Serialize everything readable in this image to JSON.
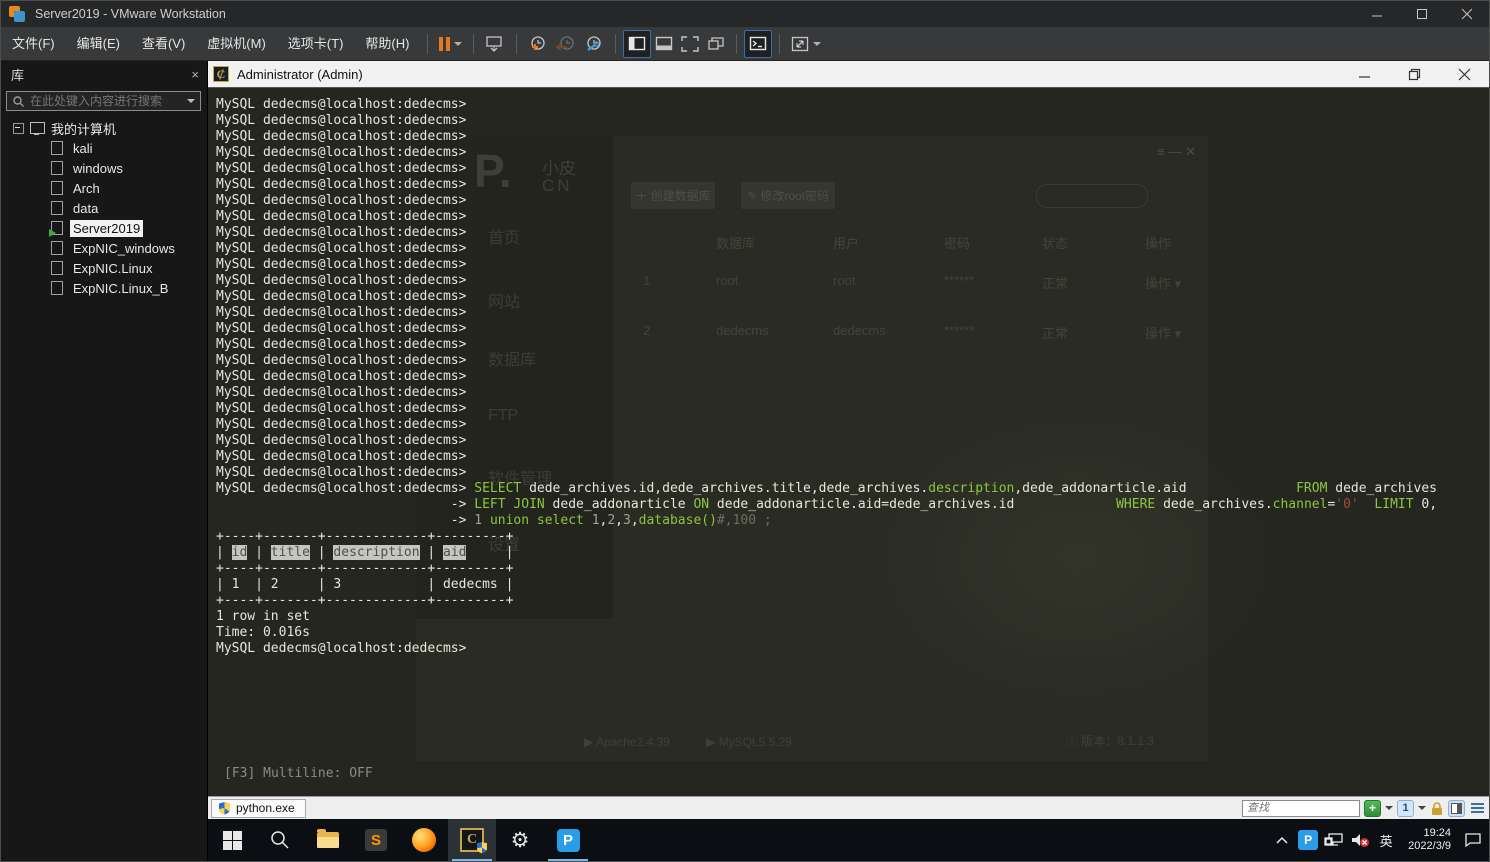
{
  "titlebar": {
    "title": "Server2019 - VMware Workstation",
    "controls": {
      "minimize": "–",
      "maximize": "",
      "close": ""
    }
  },
  "menu": {
    "items": [
      "文件(F)",
      "编辑(E)",
      "查看(V)",
      "虚拟机(M)",
      "选项卡(T)",
      "帮助(H)"
    ]
  },
  "toolbar": {
    "icon_names": [
      "pause-icon",
      "pause-dropdown-caret",
      "ctrl-alt-del-icon",
      "snapshot-take-icon",
      "snapshot-revert-icon",
      "snapshot-manager-icon",
      "library-toggle-icon",
      "thumbnail-bar-icon",
      "fullscreen-icon",
      "unity-icon",
      "console-view-icon",
      "stretch-guest-icon",
      "stretch-dropdown-caret"
    ]
  },
  "library": {
    "title": "库",
    "close_label": "×",
    "search_placeholder": "在此处键入内容进行搜索",
    "root_label": "我的计算机",
    "items": [
      {
        "label": "kali",
        "selected": false,
        "running": false
      },
      {
        "label": "windows",
        "selected": false,
        "running": false
      },
      {
        "label": "Arch",
        "selected": false,
        "running": false
      },
      {
        "label": "data",
        "selected": false,
        "running": false
      },
      {
        "label": "Server2019",
        "selected": true,
        "running": true
      },
      {
        "label": "ExpNIC_windows",
        "selected": false,
        "running": false
      },
      {
        "label": "ExpNIC.Linux",
        "selected": false,
        "running": false
      },
      {
        "label": "ExpNIC.Linux_B",
        "selected": false,
        "running": false
      }
    ]
  },
  "terminal": {
    "title": "Administrator (Admin)",
    "prompt": "MySQL dedecms@localhost:dedecms>",
    "prompt_repeat": 24,
    "lines": [
      [
        [
          "w",
          "MySQL dedecms@localhost:dedecms> "
        ],
        [
          "k",
          "SELECT"
        ],
        [
          "w",
          " dede_archives.id,dede_archives.title,dede_archives."
        ],
        [
          "k",
          "description"
        ],
        [
          "w",
          ",dede_addonarticle.aid              "
        ],
        [
          "k",
          "FROM"
        ],
        [
          "w",
          " dede_archives"
        ]
      ],
      [
        [
          "w",
          "                              -> "
        ],
        [
          "k",
          "LEFT JOIN"
        ],
        [
          "w",
          " dede_addonarticle "
        ],
        [
          "k",
          "ON"
        ],
        [
          "w",
          " dede_addonarticle.aid=dede_archives.id             "
        ],
        [
          "k",
          "WHERE"
        ],
        [
          "w",
          " dede_archives."
        ],
        [
          "k",
          "channel"
        ],
        [
          "w",
          "="
        ],
        [
          "s",
          "'0'"
        ],
        [
          "w",
          "  "
        ],
        [
          "k",
          "LIMIT"
        ],
        [
          "w",
          " 0,"
        ]
      ],
      [
        [
          "w",
          "                              -> "
        ],
        [
          "n",
          "1"
        ],
        [
          "w",
          " "
        ],
        [
          "k",
          "union select"
        ],
        [
          "w",
          " "
        ],
        [
          "n",
          "1"
        ],
        [
          "w",
          ","
        ],
        [
          "n",
          "2"
        ],
        [
          "w",
          ","
        ],
        [
          "n",
          "3"
        ],
        [
          "w",
          ","
        ],
        [
          "k",
          "database()"
        ],
        [
          "c",
          "#,100 ;"
        ]
      ],
      [
        [
          "w",
          "+----+-------+-------------+---------+"
        ]
      ],
      [
        [
          "w",
          "| "
        ],
        [
          "sel",
          "id"
        ],
        [
          "w",
          " | "
        ],
        [
          "sel",
          "title"
        ],
        [
          "w",
          " | "
        ],
        [
          "sel",
          "description"
        ],
        [
          "w",
          " | "
        ],
        [
          "sel",
          "aid"
        ],
        [
          "w",
          "     |"
        ]
      ],
      [
        [
          "w",
          "+----+-------+-------------+---------+"
        ]
      ],
      [
        [
          "w",
          "| 1  | 2     | 3           | dedecms |"
        ]
      ],
      [
        [
          "w",
          "+----+-------+-------------+---------+"
        ]
      ],
      [
        [
          "w",
          "1 row in set"
        ]
      ],
      [
        [
          "w",
          "Time: 0.016s"
        ]
      ],
      [
        [
          "w",
          "MySQL dedecms@localhost:dedecms>"
        ]
      ]
    ],
    "status_line": "[F3] Multiline: OFF",
    "tab_label": "python.exe",
    "find_placeholder": "查找",
    "new_console_label": "+",
    "console_number_label": "1"
  },
  "phpstudy": {
    "logo_p": "P.",
    "logo_sub1": "小皮",
    "logo_sub2": "CN",
    "nav": [
      "首页",
      "网站",
      "数据库",
      "FTP",
      "软件管理",
      "设置"
    ],
    "btn_create": "＋ 创建数据库",
    "btn_root": "✎ 修改root密码",
    "controls": "≡   —   ✕",
    "table_headers": [
      "数据库",
      "用户",
      "密码",
      "状态",
      "操作"
    ],
    "rows": [
      [
        "1",
        "root",
        "root",
        "******",
        "正常",
        "操作 ▾"
      ],
      [
        "2",
        "dedecms",
        "dedecms",
        "******",
        "正常",
        "操作 ▾"
      ]
    ],
    "footer_apache": "▶ Apache2.4.39",
    "footer_mysql": "▶ MySQL5.5.29",
    "footer_version": "ⓘ 版本：8.1.1.3"
  },
  "taskbar": {
    "apps": [
      "start",
      "search",
      "file-explorer",
      "sublime-text",
      "firefox",
      "cmder",
      "settings",
      "phpstudy"
    ],
    "tray_lang": "英",
    "tray_time": "19:24",
    "tray_date": "2022/3/9"
  },
  "colors": {
    "keyword_green": "#8ec63f",
    "string_red": "#a34a42",
    "accent_blue": "#3a6ea5",
    "taskbar_underline": "#76b9ed",
    "cmder_gold": "#c9a54a"
  }
}
